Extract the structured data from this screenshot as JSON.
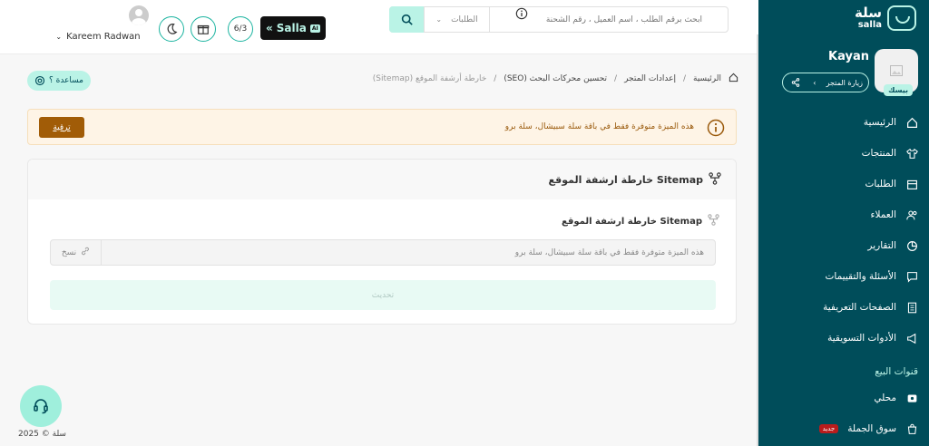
{
  "sidebar": {
    "brand_ar": "سلة",
    "brand_en": "salla",
    "store_name": "Kayan",
    "plan_badge": "بيسك",
    "visit_store": "زيارة المتجر",
    "items": [
      {
        "label": "الرئيسية",
        "icon": "home-icon"
      },
      {
        "label": "المنتجات",
        "icon": "shirt-icon"
      },
      {
        "label": "الطلبات",
        "icon": "box-icon"
      },
      {
        "label": "العملاء",
        "icon": "users-icon"
      },
      {
        "label": "التقارير",
        "icon": "pie-chart-icon"
      },
      {
        "label": "الأسئلة والتقييمات",
        "icon": "comment-icon"
      },
      {
        "label": "الصفحات التعريفية",
        "icon": "pages-icon"
      },
      {
        "label": "الأدوات التسويقية",
        "icon": "megaphone-icon"
      }
    ],
    "section_title": "قنوات البيع",
    "channels": [
      {
        "label": "محلي",
        "icon": "store-icon"
      },
      {
        "label": "سوق الجملة",
        "icon": "bag-icon",
        "badge": "جديد"
      }
    ]
  },
  "topbar": {
    "search_placeholder": "ابحث برقم الطلب ، اسم العميل ، رقم الشحنة",
    "search_scope": "الطلبات",
    "salla_label": "Salla",
    "salla_ai": "AI",
    "progress": "6/3",
    "user_name": "Kareem Radwan"
  },
  "breadcrumb": {
    "home": "الرئيسية",
    "settings": "إعدادات المتجر",
    "seo": "تحسين محركات البحث (SEO)",
    "current": "خارطة أرشفة الموقع (Sitemap)"
  },
  "help_label": "مساعدة ؟",
  "warning": {
    "text": "هذه الميزة متوفرة فقط في باقة سلة سبيشال، سلة برو",
    "upgrade_label": "ترقية"
  },
  "card": {
    "title": "خارطة ارشفة الموقع Sitemap",
    "field_label": "خارطة ارشفة الموقع Sitemap",
    "field_value": "هذه الميزة متوفرة فقط في باقة سلة سبيشال، سلة برو",
    "copy_label": "نسخ",
    "update_label": "تحديث"
  },
  "footer": {
    "copyright": "سلة © 2025"
  },
  "colors": {
    "sidebar_bg": "#004d5a",
    "accent": "#baf3e6",
    "upgrade": "#a15c07"
  }
}
